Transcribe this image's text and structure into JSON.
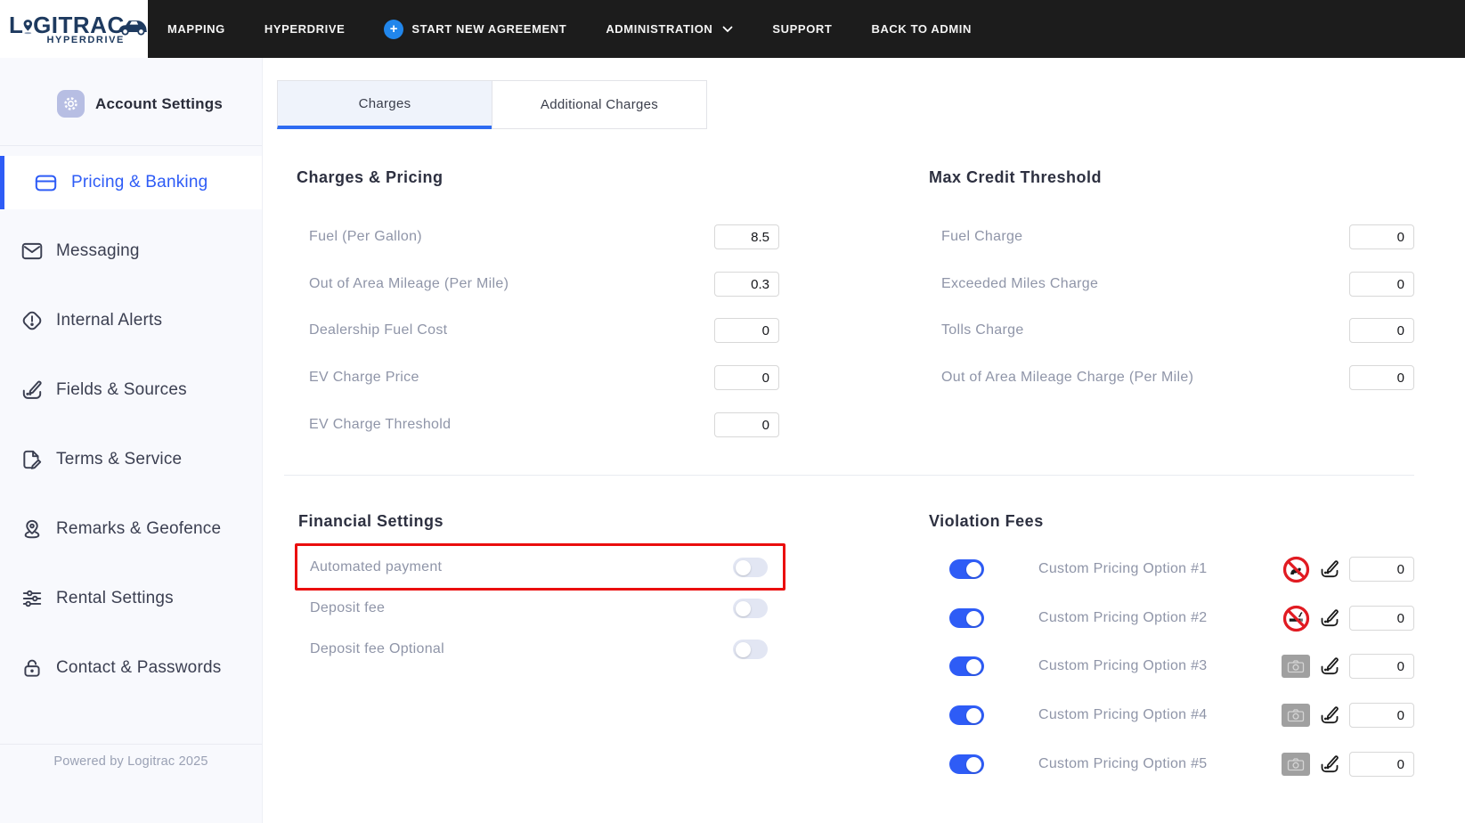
{
  "brand": {
    "line1": "LGITRAC",
    "line1_a": "L",
    "line1_b": "GITRAC",
    "line2": "HYPERDRIVE"
  },
  "nav": {
    "mapping": "MAPPING",
    "hyperdrive": "HYPERDRIVE",
    "start_new_agreement": "START NEW AGREEMENT",
    "administration": "ADMINISTRATION",
    "support": "SUPPORT",
    "back_to_admin": "BACK TO ADMIN",
    "plus_glyph": "+"
  },
  "sidebar": {
    "header": "Account Settings",
    "items": [
      {
        "label": "Pricing & Banking",
        "active": true
      },
      {
        "label": "Messaging",
        "active": false
      },
      {
        "label": "Internal Alerts",
        "active": false
      },
      {
        "label": "Fields & Sources",
        "active": false
      },
      {
        "label": "Terms & Service",
        "active": false
      },
      {
        "label": "Remarks & Geofence",
        "active": false
      },
      {
        "label": "Rental Settings",
        "active": false
      },
      {
        "label": "Contact & Passwords",
        "active": false
      }
    ],
    "footer": "Powered by Logitrac 2025"
  },
  "tabs": {
    "charges": "Charges",
    "additional_charges": "Additional Charges",
    "active": "Charges"
  },
  "charges_pricing": {
    "title": "Charges & Pricing",
    "rows": [
      {
        "label": "Fuel (Per Gallon)",
        "value": "8.5"
      },
      {
        "label": "Out of Area Mileage (Per Mile)",
        "value": "0.3"
      },
      {
        "label": "Dealership Fuel Cost",
        "value": "0"
      },
      {
        "label": "EV Charge Price",
        "value": "0"
      },
      {
        "label": "EV Charge Threshold",
        "value": "0"
      }
    ]
  },
  "max_credit": {
    "title": "Max Credit Threshold",
    "rows": [
      {
        "label": "Fuel Charge",
        "value": "0"
      },
      {
        "label": "Exceeded Miles Charge",
        "value": "0"
      },
      {
        "label": "Tolls Charge",
        "value": "0"
      },
      {
        "label": "Out of Area Mileage Charge (Per Mile)",
        "value": "0"
      }
    ]
  },
  "financial": {
    "title": "Financial Settings",
    "rows": [
      {
        "label": "Automated payment",
        "on": false,
        "highlighted": true
      },
      {
        "label": "Deposit fee",
        "on": false,
        "highlighted": false
      },
      {
        "label": "Deposit fee Optional",
        "on": false,
        "highlighted": false
      }
    ]
  },
  "violation": {
    "title": "Violation Fees",
    "rows": [
      {
        "label": "Custom Pricing Option #1",
        "on": true,
        "icon": "no-pets-icon",
        "value": "0"
      },
      {
        "label": "Custom Pricing Option #2",
        "on": true,
        "icon": "no-smoking-icon",
        "value": "0"
      },
      {
        "label": "Custom Pricing Option #3",
        "on": true,
        "icon": "camera-placeholder-icon",
        "value": "0"
      },
      {
        "label": "Custom Pricing Option #4",
        "on": true,
        "icon": "camera-placeholder-icon",
        "value": "0"
      },
      {
        "label": "Custom Pricing Option #5",
        "on": true,
        "icon": "camera-placeholder-icon",
        "value": "0"
      }
    ]
  },
  "colors": {
    "accent_blue": "#2e5cf6",
    "tab_underline": "#2e6bf2",
    "nav_bg": "#1c1c1c",
    "logo_navy": "#1e3a5f",
    "annotation_red": "#ea0e0e",
    "prohibition_red": "#e11b22",
    "toggle_off_track": "#e2e6f3",
    "camera_gray": "#a0a0a0",
    "label_gray": "#8f95a8",
    "plus_button_blue": "#2186eb"
  },
  "icons": {
    "gear": "gear-icon",
    "credit_card": "credit-card-icon",
    "envelope": "envelope-icon",
    "alert": "alert-icon",
    "signature": "signature-edit-icon",
    "document_pen": "document-pen-icon",
    "geofence_pin": "geofence-pin-icon",
    "sliders": "sliders-icon",
    "padlock": "padlock-icon",
    "location_pin": "location-pin-icon",
    "car": "car-icon",
    "chevron_down": "chevron-down-icon",
    "plus": "plus-icon",
    "no_pets": "no-pets-icon",
    "no_smoking": "no-smoking-icon",
    "camera": "camera-placeholder-icon",
    "edit": "edit-icon"
  }
}
